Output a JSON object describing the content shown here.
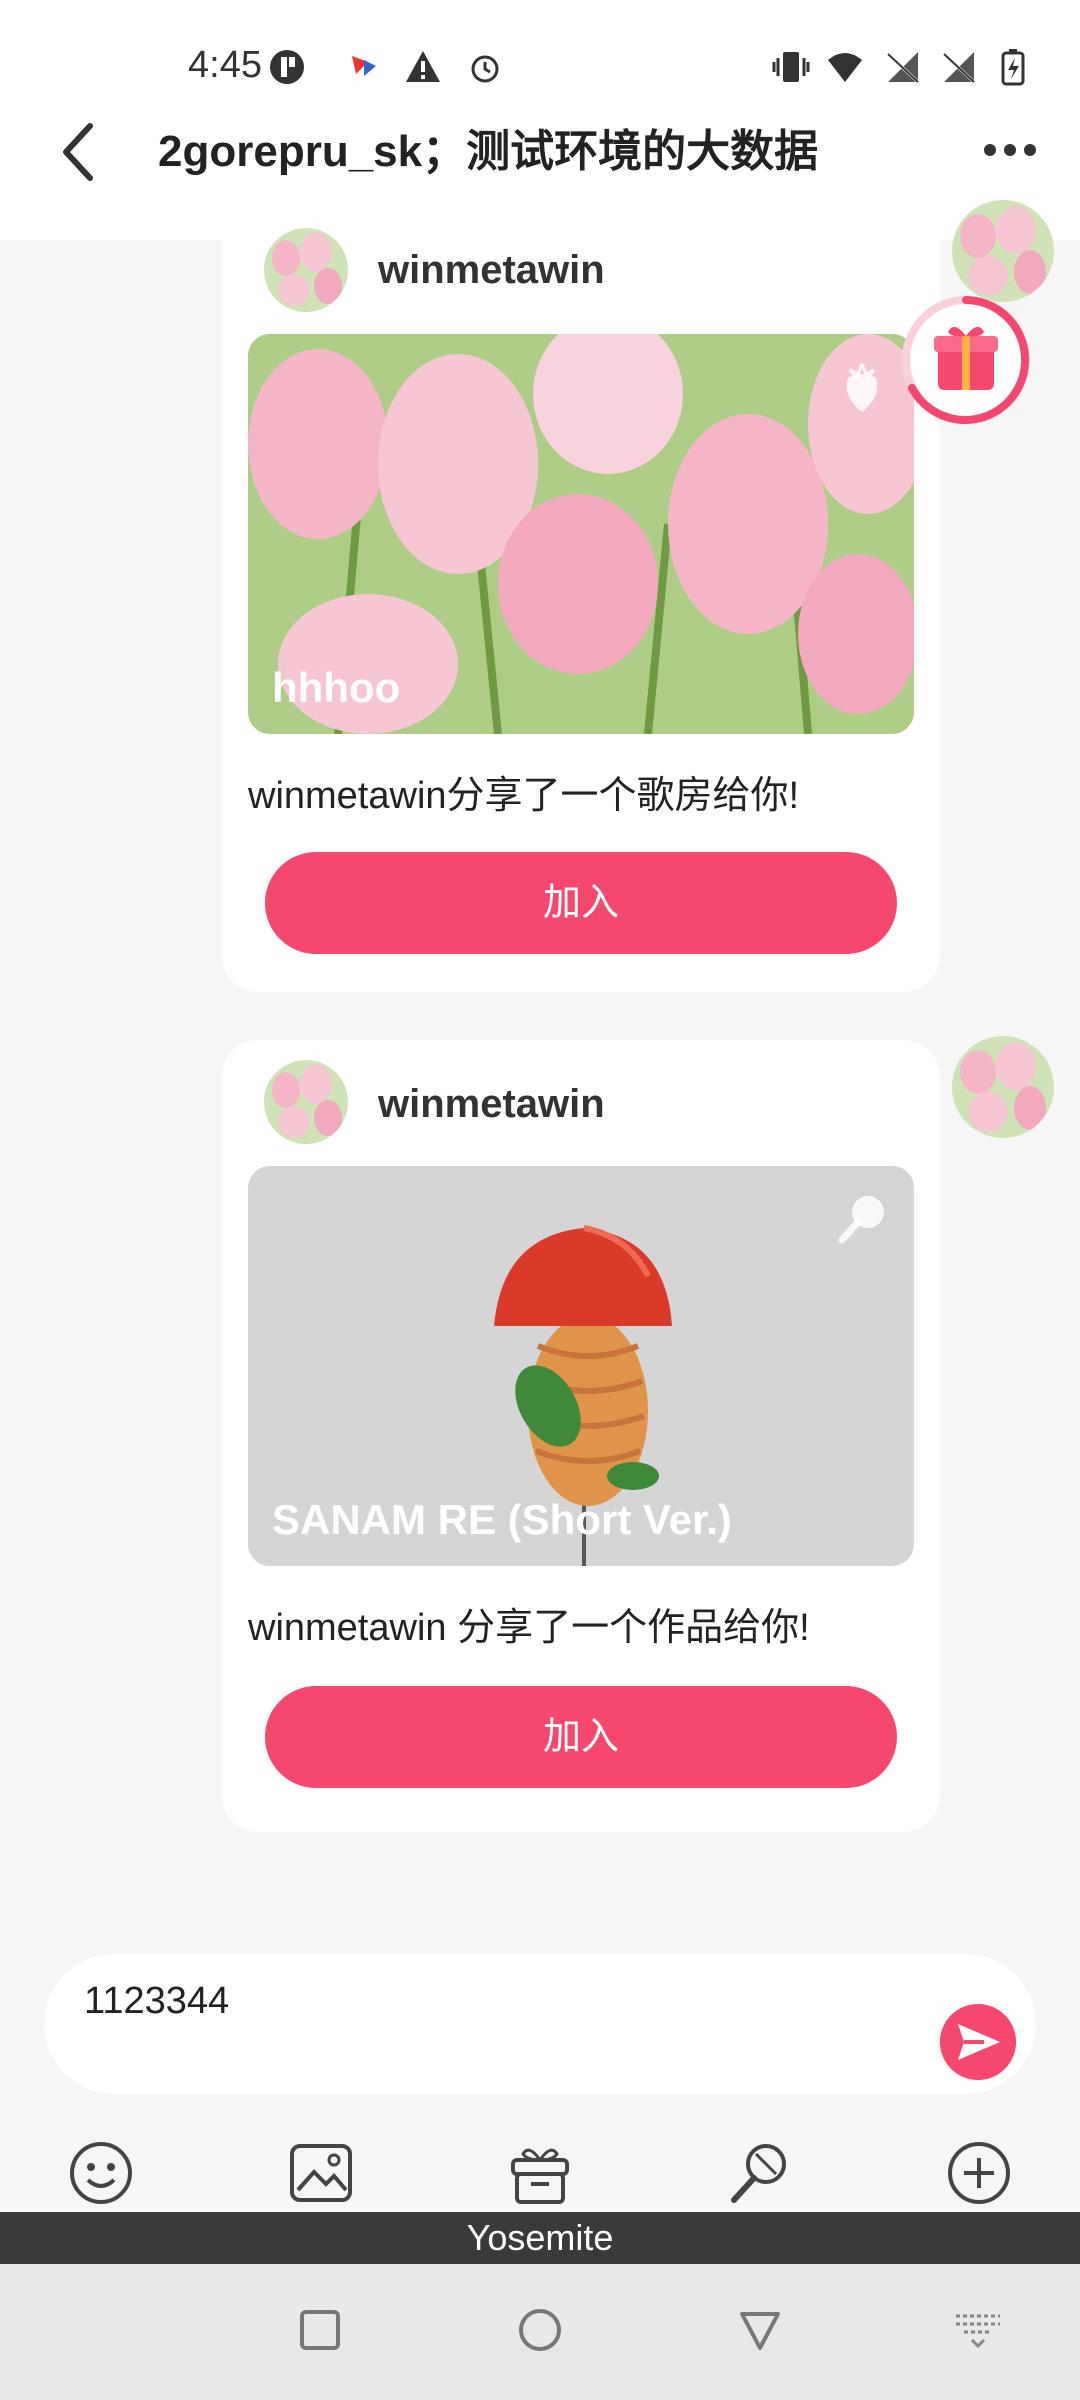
{
  "status_bar": {
    "time": "4:45"
  },
  "header": {
    "title": "2gorepru_sk；测试环境的大数据"
  },
  "messages": [
    {
      "username": "winmetawin",
      "media_title": "hhhoo",
      "description": "winmetawin分享了一个歌房给你!",
      "button_label": "加入",
      "media_icon": "strawberry-icon"
    },
    {
      "username": "winmetawin",
      "media_title": "SANAM RE (Short Ver.)",
      "description": "winmetawin 分享了一个作品给你!",
      "button_label": "加入",
      "media_icon": "mic-icon"
    }
  ],
  "input": {
    "value": "1123344"
  },
  "ime": {
    "label": "Yosemite"
  },
  "colors": {
    "accent": "#f6476f",
    "background": "#f6f6f6"
  }
}
